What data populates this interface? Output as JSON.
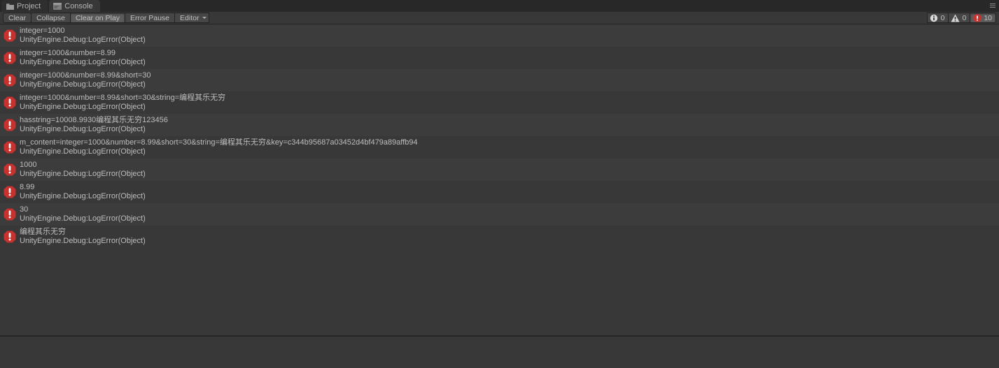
{
  "tabs": {
    "project": "Project",
    "console": "Console"
  },
  "toolbar": {
    "clear": "Clear",
    "collapse": "Collapse",
    "clear_on_play": "Clear on Play",
    "error_pause": "Error Pause",
    "editor": "Editor"
  },
  "counters": {
    "info": "0",
    "warn": "0",
    "error": "10"
  },
  "log_sub": "UnityEngine.Debug:LogError(Object)",
  "logs": [
    {
      "msg": "integer=1000"
    },
    {
      "msg": "integer=1000&number=8.99"
    },
    {
      "msg": "integer=1000&number=8.99&short=30"
    },
    {
      "msg": "integer=1000&number=8.99&short=30&string=编程其乐无穷"
    },
    {
      "msg": "hasstring=10008.9930编程其乐无穷123456"
    },
    {
      "msg": "m_content=integer=1000&number=8.99&short=30&string=编程其乐无穷&key=c344b95687a03452d4bf479a89affb94"
    },
    {
      "msg": "1000"
    },
    {
      "msg": "8.99"
    },
    {
      "msg": "30"
    },
    {
      "msg": "编程其乐无穷"
    }
  ]
}
